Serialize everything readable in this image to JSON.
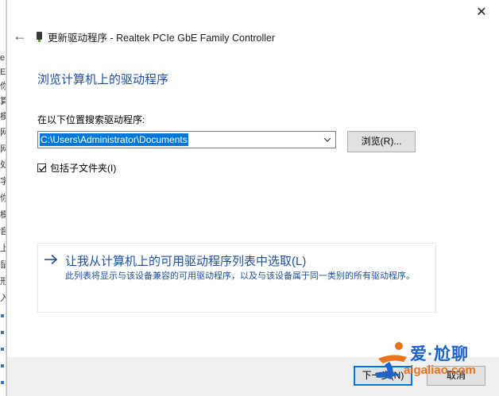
{
  "background_window": {
    "chars": [
      "e",
      "E",
      "你",
      "算",
      "模",
      "网",
      "网",
      "处",
      "字",
      "你",
      "模",
      "音",
      "上",
      "鼠",
      "形",
      "入"
    ]
  },
  "dialog": {
    "close_glyph": "✕",
    "back_glyph": "←",
    "title": "更新驱动程序 - Realtek PCIe GbE Family Controller",
    "heading": "浏览计算机上的驱动程序",
    "search_label": "在以下位置搜索驱动程序:",
    "path_value": "C:\\Users\\Administrator\\Documents",
    "browse_label": "浏览(R)...",
    "include_subfolders_label": "包括子文件夹(I)",
    "include_subfolders_checked": true,
    "pick_link_title": "让我从计算机上的可用驱动程序列表中选取(L)",
    "pick_link_desc": "此列表将显示与该设备兼容的可用驱动程序，以及与该设备属于同一类别的所有驱动程序。",
    "next_label": "下一步(N)",
    "cancel_label": "取消"
  },
  "watermark": {
    "main": "爱·尬聊",
    "sub": "aigaliao.com"
  },
  "colors": {
    "accent": "#0078d7",
    "link": "#1c4f9c",
    "watermark_blue": "#1f63c6",
    "watermark_orange": "#e8741e"
  }
}
